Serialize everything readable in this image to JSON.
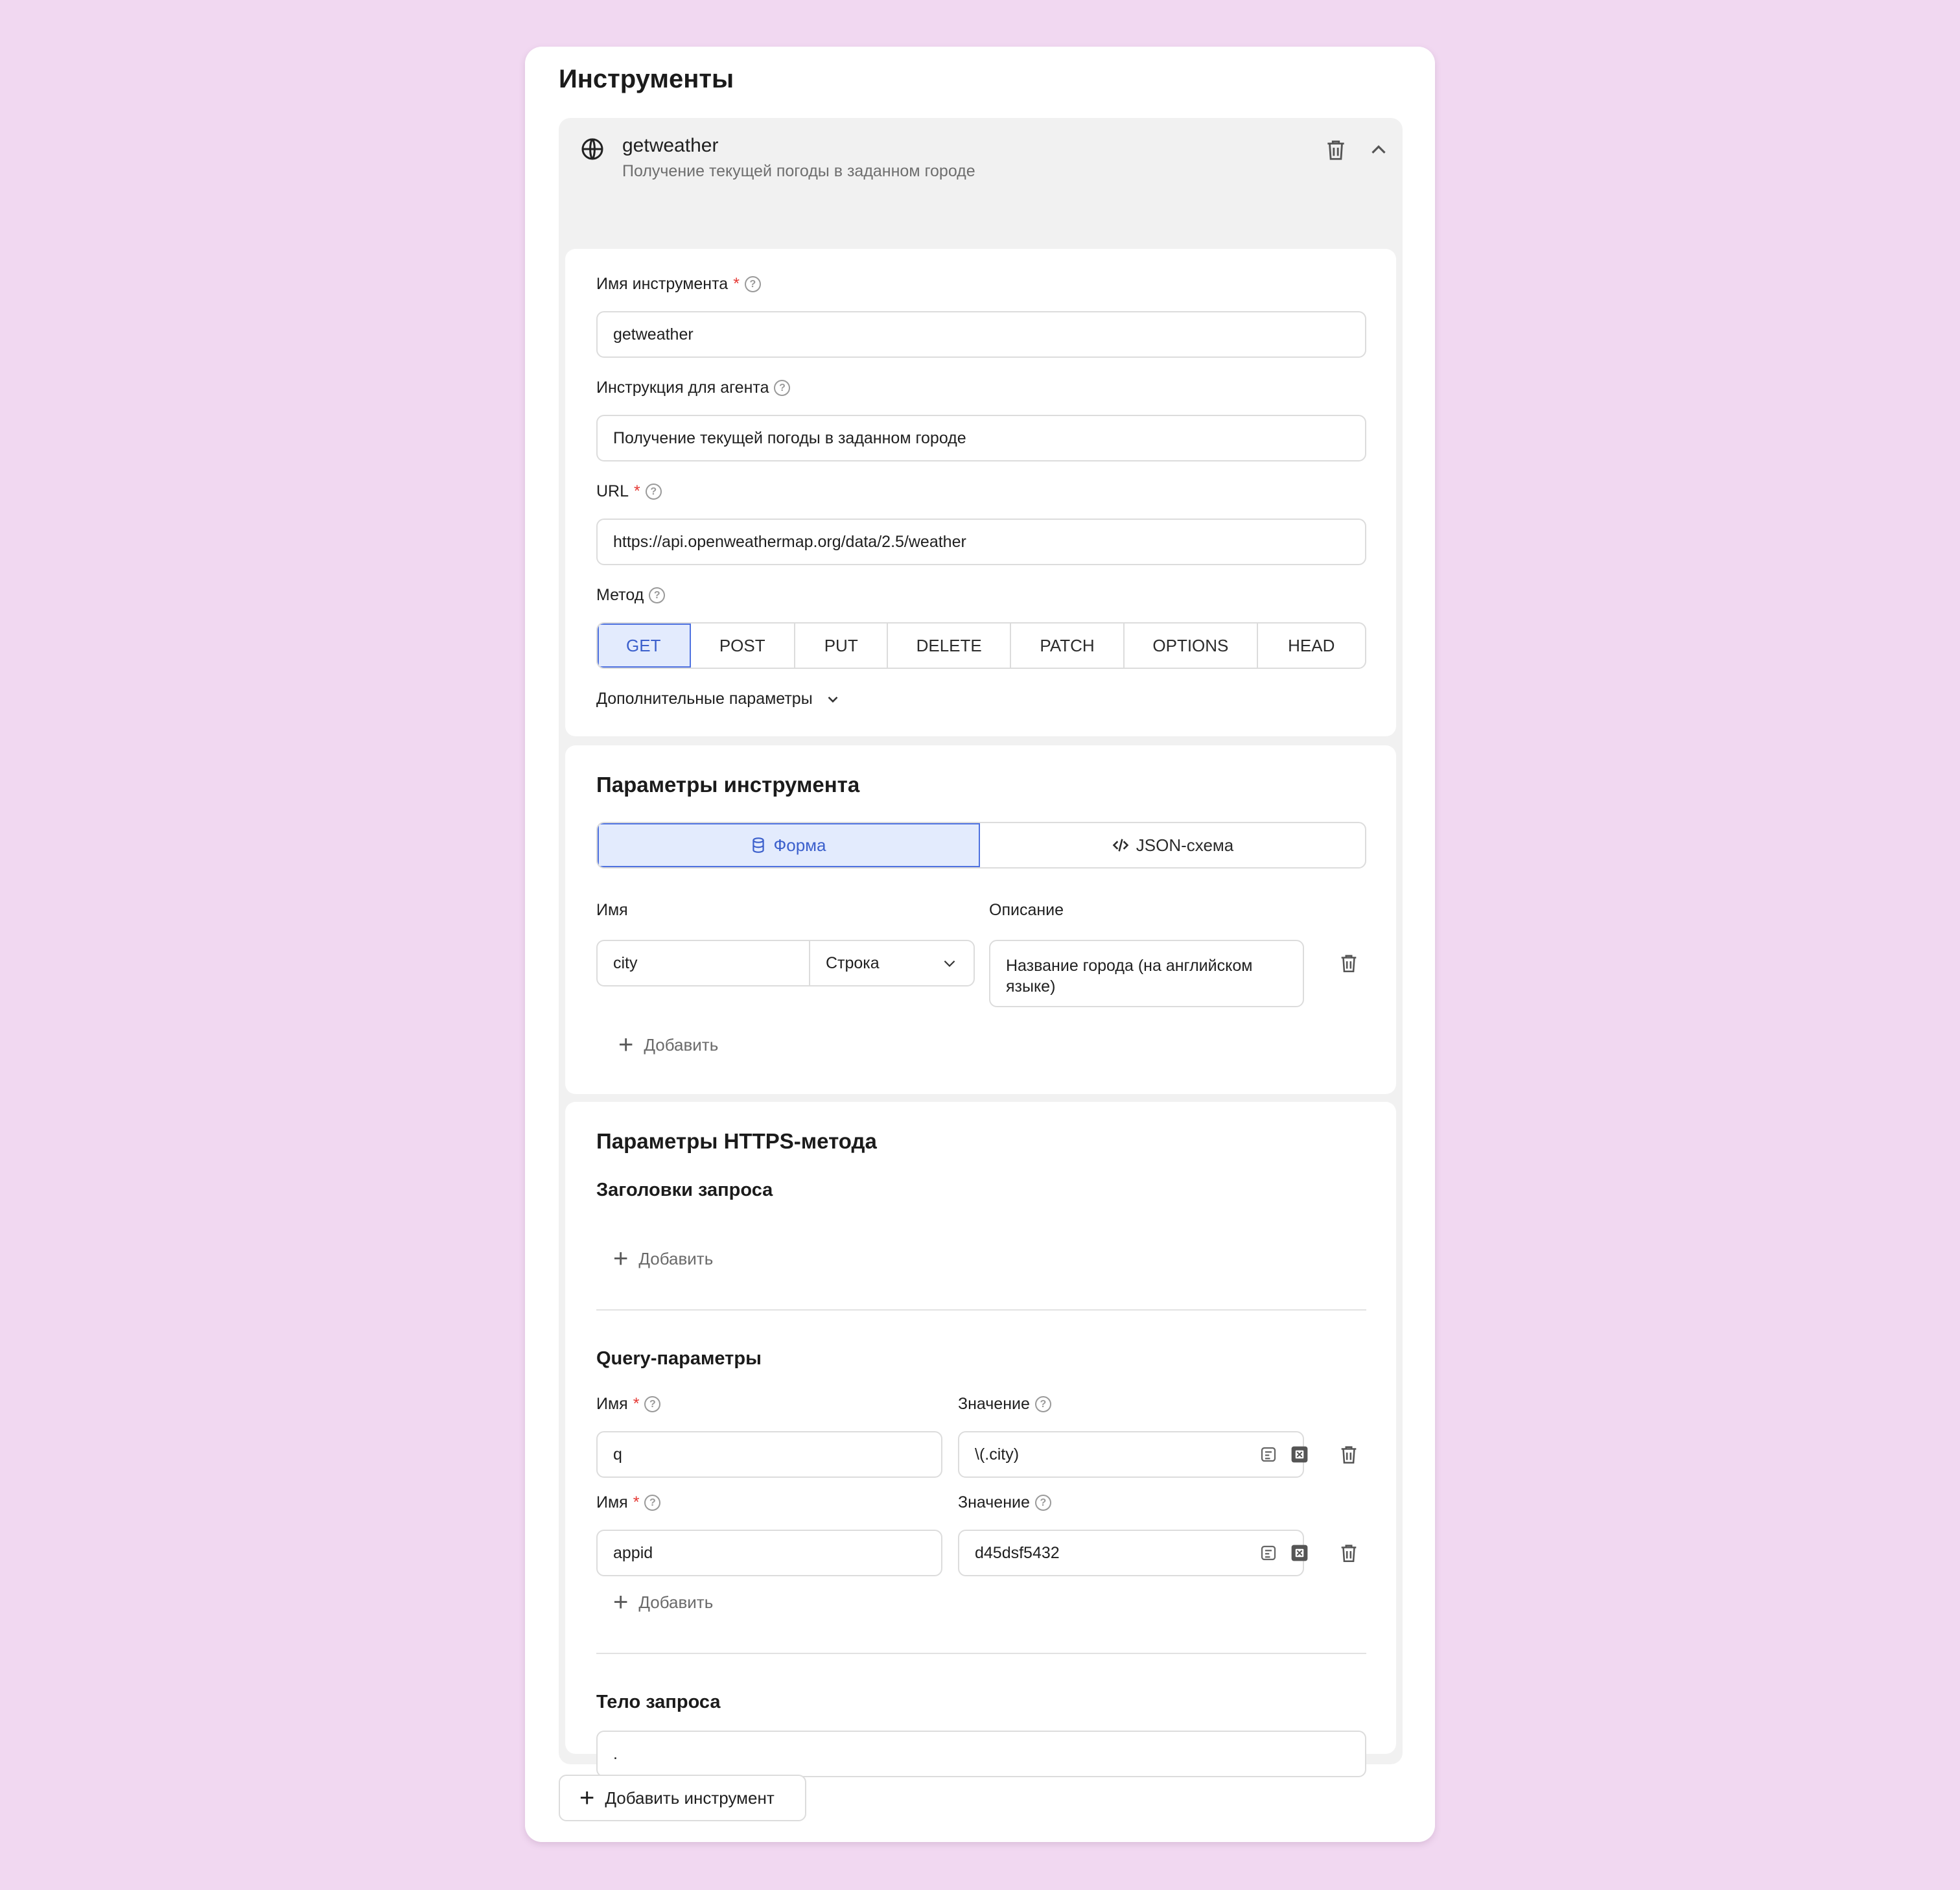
{
  "card": {
    "title": "Инструменты"
  },
  "tool": {
    "name": "getweather",
    "description": "Получение текущей погоды в заданном городе"
  },
  "basic": {
    "name_label": "Имя инструмента",
    "name_value": "getweather",
    "instruction_label": "Инструкция для агента",
    "instruction_value": "Получение текущей погоды в заданном городе",
    "url_label": "URL",
    "url_value": "https://api.openweathermap.org/data/2.5/weather",
    "method_label": "Метод",
    "methods": [
      "GET",
      "POST",
      "PUT",
      "DELETE",
      "PATCH",
      "OPTIONS",
      "HEAD"
    ],
    "active_method": "GET",
    "advanced_label": "Дополнительные параметры",
    "required_mark": "*",
    "help_mark": "?"
  },
  "params": {
    "title": "Параметры инструмента",
    "tab_form": "Форма",
    "tab_json": "JSON-схема",
    "name_col": "Имя",
    "desc_col": "Описание",
    "row": {
      "name": "city",
      "type": "Строка",
      "description": "Название города (на английском языке)"
    },
    "add_label": "Добавить"
  },
  "https": {
    "title": "Параметры HTTPS-метода",
    "headers_title": "Заголовки запроса",
    "headers_add": "Добавить",
    "query_title": "Query-параметры",
    "query_name_label": "Имя",
    "query_value_label": "Значение",
    "query_rows": [
      {
        "name": "q",
        "value": "\\(.city)"
      },
      {
        "name": "appid",
        "value": "d45dsf5432"
      }
    ],
    "query_add": "Добавить",
    "body_title": "Тело запроса",
    "body_value": "."
  },
  "footer": {
    "add_tool": "Добавить инструмент"
  }
}
